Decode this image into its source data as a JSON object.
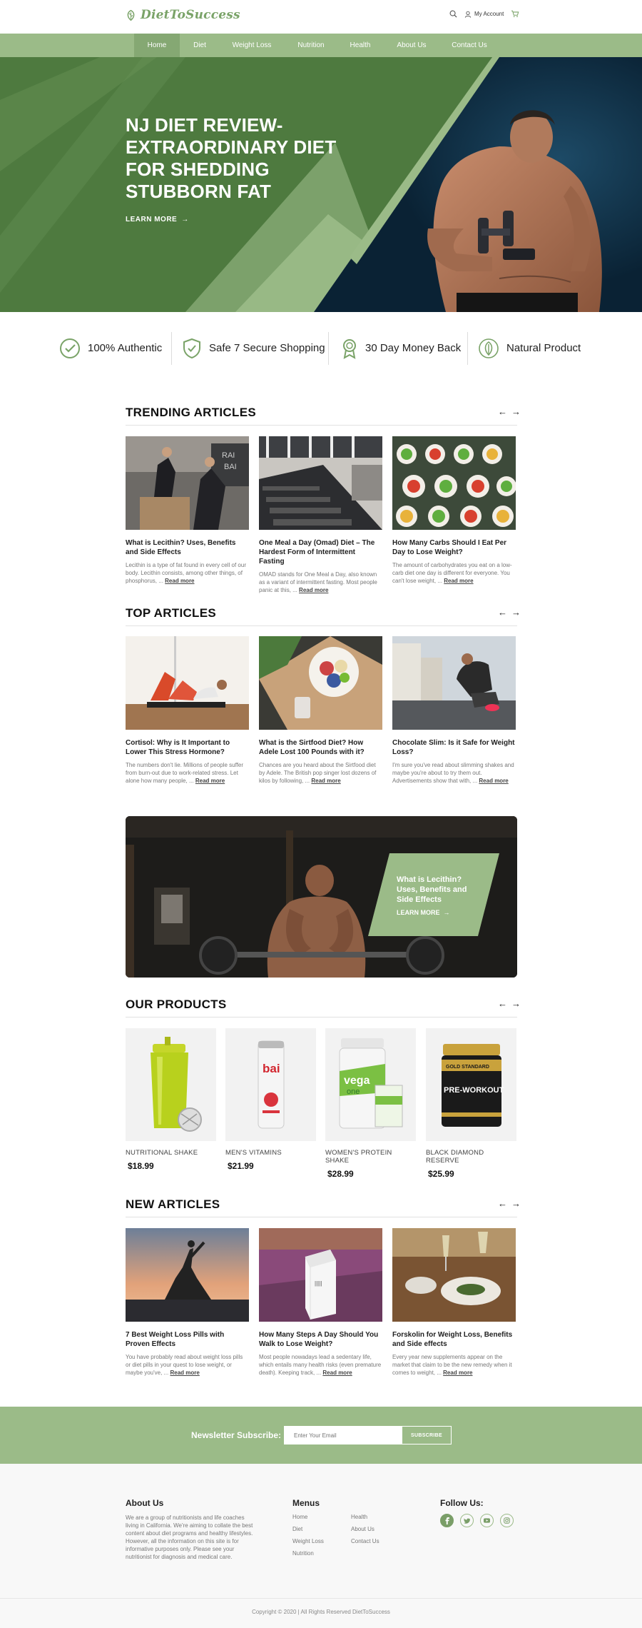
{
  "brand": {
    "name": "DietToSuccess",
    "accent": "#9bbb88",
    "accent_dark": "#4e7a3f"
  },
  "header": {
    "account_label": "My Account",
    "icons": [
      "search-icon",
      "user-icon",
      "cart-icon"
    ]
  },
  "nav": {
    "items": [
      "Home",
      "Diet",
      "Weight Loss",
      "Nutrition",
      "Health",
      "About Us",
      "Contact Us"
    ],
    "active": "Home"
  },
  "hero": {
    "title": "NJ DIET REVIEW- EXTRAORDINARY DIET FOR SHEDDING STUBBORN FAT",
    "cta": "LEARN MORE"
  },
  "features": [
    {
      "label": "100% Authentic",
      "icon": "check-circle-icon"
    },
    {
      "label": "Safe 7 Secure Shopping",
      "icon": "shield-check-icon"
    },
    {
      "label": "30 Day Money Back",
      "icon": "award-badge-icon"
    },
    {
      "label": "Natural Product",
      "icon": "leaf-icon"
    }
  ],
  "trending": {
    "title": "TRENDING ARTICLES",
    "articles": [
      {
        "title": "What is Lecithin? Uses, Benefits and Side Effects",
        "excerpt": "Lecithin is a type of fat found in every cell of our body. Lecithin consists, among other things, of phosphorus, ...",
        "more": "Read more"
      },
      {
        "title": "One Meal a Day (Omad) Diet – The Hardest Form of Intermittent Fasting",
        "excerpt": "OMAD stands for One Meal a Day, also known as a variant of intermittent fasting. Most people panic at this, ...",
        "more": "Read more"
      },
      {
        "title": "How Many Carbs Should I Eat Per Day to Lose Weight?",
        "excerpt": "The amount of carbohydrates you eat on a low-carb diet one day is different for everyone. You can't lose weight, ...",
        "more": "Read more"
      }
    ]
  },
  "top": {
    "title": "TOP ARTICLES",
    "articles": [
      {
        "title": "Cortisol: Why is It Important to Lower This Stress Hormone?",
        "excerpt": "The numbers don't lie. Millions of people suffer from burn-out due to work-related stress. Let alone how many people, ...",
        "more": "Read more"
      },
      {
        "title": "What is the Sirtfood Diet? How Adele Lost 100 Pounds with it?",
        "excerpt": "Chances are you heard about the Sirtfood diet by Adele. The British pop singer lost dozens of kilos by following, ...",
        "more": "Read more"
      },
      {
        "title": "Chocolate Slim: Is it Safe for Weight Loss?",
        "excerpt": "I'm sure you've read about slimming shakes and maybe you're about to try them out. Advertisements show that with, ...",
        "more": "Read more"
      }
    ]
  },
  "promo": {
    "title": "What is Lecithin? Uses, Benefits and Side Effects",
    "cta": "LEARN MORE"
  },
  "products": {
    "title": "OUR PRODUCTS",
    "items": [
      {
        "name": "NUTRITIONAL SHAKE",
        "price": "$18.99"
      },
      {
        "name": "MEN'S VITAMINS",
        "price": "$21.99"
      },
      {
        "name": "WOMEN'S PROTEIN SHAKE",
        "price": "$28.99"
      },
      {
        "name": "BLACK DIAMOND RESERVE",
        "price": "$25.99"
      }
    ],
    "package_text": {
      "can": "bai",
      "vega": "vega",
      "vega_sub": "one",
      "gold_brand": "GOLD STANDARD",
      "gold_name": "PRE-WORKOUT"
    }
  },
  "new": {
    "title": "NEW ARTICLES",
    "articles": [
      {
        "title": "7 Best Weight Loss Pills with Proven Effects",
        "excerpt": "You have probably read about weight loss pills or diet pills in your quest to lose weight, or maybe you've, ...",
        "more": "Read more"
      },
      {
        "title": "How Many Steps A Day Should You Walk to Lose Weight?",
        "excerpt": "Most people nowadays lead a sedentary life, which entails many health risks (even premature death). Keeping track, ...",
        "more": "Read more"
      },
      {
        "title": "Forskolin for Weight Loss, Benefits and Side effects",
        "excerpt": "Every year new supplements appear on the market that claim to be the new remedy when it comes to weight, ...",
        "more": "Read more"
      }
    ]
  },
  "newsletter": {
    "label": "Newsletter Subscribe:",
    "placeholder": "Enter Your Email",
    "button": "SUBSCRIBE"
  },
  "footer": {
    "about_title": "About Us",
    "about_text": "We are a group of nutritionists and life coaches living in California. We're aiming to collate the best content about diet programs and healthy lifestyles. However, all the information on this site is for informative purposes only. Please see your nutritionist for diagnosis and medical care.",
    "menus_title": "Menus",
    "menu_col1": [
      "Home",
      "Diet",
      "Weight Loss",
      "Nutrition"
    ],
    "menu_col2": [
      "Health",
      "About Us",
      "Contact Us"
    ],
    "follow_title": "Follow Us:",
    "social": [
      "facebook-icon",
      "twitter-icon",
      "youtube-icon",
      "instagram-icon"
    ],
    "copyright": "Copyright © 2020 | All Rights Reserved DietToSuccess"
  }
}
